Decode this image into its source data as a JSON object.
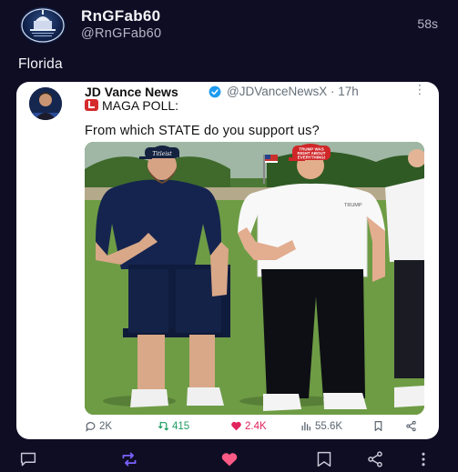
{
  "post": {
    "author_name": "RnGFab60",
    "author_handle": "@RnGFab60",
    "time": "58s",
    "text": "Florida"
  },
  "quoted": {
    "author_name": "JD Vance News",
    "author_handle": "@JDVanceNewsX · 17h",
    "poll_title": "MAGA POLL:",
    "question": "From which STATE do you support us?",
    "photo_text": {
      "cap_left": "Titleist",
      "cap_right_line1": "TRUMP WAS",
      "cap_right_line2": "RIGHT ABOUT",
      "cap_right_line3": "EVERYTHING!",
      "shirt_right": "TRUMP"
    },
    "actions": {
      "replies": "2K",
      "reposts": "415",
      "likes": "2.4K",
      "views": "55.6K"
    }
  },
  "icons": {
    "more": "more-dots-icon",
    "reply": "reply-icon",
    "repost": "repost-icon",
    "like": "heart-icon",
    "views": "views-bars-icon",
    "bookmark": "bookmark-icon",
    "share": "share-icon"
  },
  "colors": {
    "background": "#0f0d24",
    "repost_accent": "#7b61ff",
    "like_accent": "#ff5a85",
    "verified": "#1d9bf0"
  }
}
